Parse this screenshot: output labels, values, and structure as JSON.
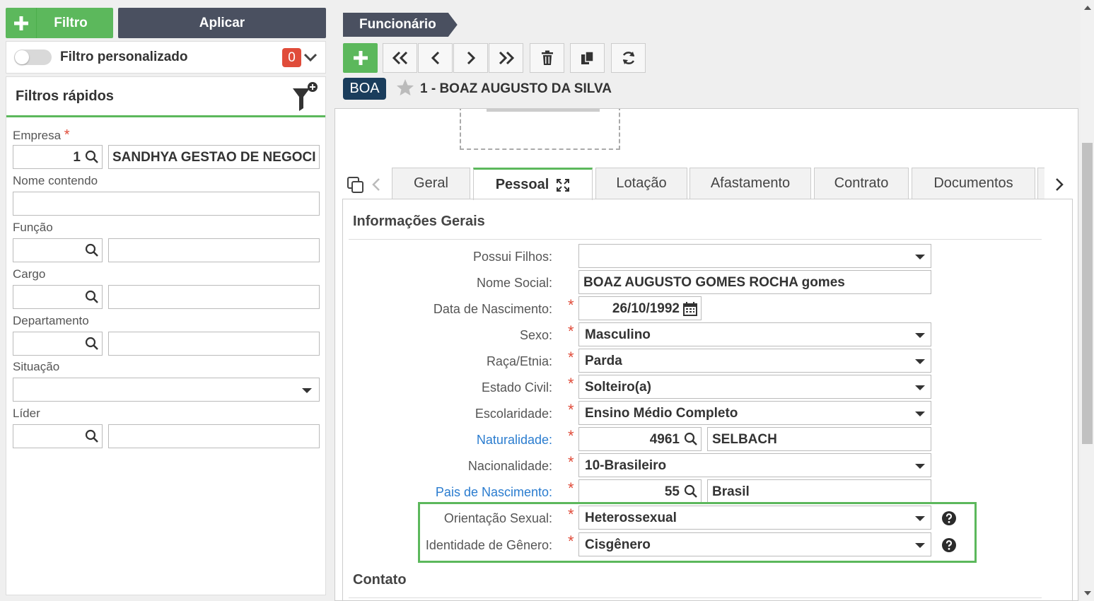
{
  "left": {
    "filter_button": "Filtro",
    "apply_button": "Aplicar",
    "custom_filter": {
      "label": "Filtro personalizado",
      "count": "0"
    },
    "quick_filters": {
      "title": "Filtros rápidos",
      "empresa": {
        "label": "Empresa",
        "code": "1",
        "name": "SANDHYA GESTAO DE NEGOCIOS"
      },
      "nome_contendo": {
        "label": "Nome contendo",
        "value": ""
      },
      "funcao": {
        "label": "Função"
      },
      "cargo": {
        "label": "Cargo"
      },
      "departamento": {
        "label": "Departamento"
      },
      "situacao": {
        "label": "Situação"
      },
      "lider": {
        "label": "Líder"
      }
    }
  },
  "header": {
    "breadcrumb": "Funcionário",
    "abbr": "BOA",
    "record_title": "1 - BOAZ AUGUSTO DA SILVA"
  },
  "tabs": [
    {
      "label": "Geral"
    },
    {
      "label": "Pessoal"
    },
    {
      "label": "Lotação"
    },
    {
      "label": "Afastamento"
    },
    {
      "label": "Contrato"
    },
    {
      "label": "Documentos"
    }
  ],
  "form": {
    "section_general": "Informações Gerais",
    "possui_filhos": {
      "label": "Possui Filhos:",
      "value": ""
    },
    "nome_social": {
      "label": "Nome Social:",
      "value": "BOAZ AUGUSTO GOMES ROCHA gomes"
    },
    "data_nascimento": {
      "label": "Data de Nascimento:",
      "value": "26/10/1992"
    },
    "sexo": {
      "label": "Sexo:",
      "value": "Masculino"
    },
    "raca": {
      "label": "Raça/Etnia:",
      "value": "Parda"
    },
    "estado_civil": {
      "label": "Estado Civil:",
      "value": "Solteiro(a)"
    },
    "escolaridade": {
      "label": "Escolaridade:",
      "value": "Ensino Médio Completo"
    },
    "naturalidade": {
      "label": "Naturalidade:",
      "code": "4961",
      "name": "SELBACH"
    },
    "nacionalidade": {
      "label": "Nacionalidade:",
      "value": "10-Brasileiro"
    },
    "pais_nascimento": {
      "label": "Pais de Nascimento:",
      "code": "55",
      "name": "Brasil"
    },
    "orientacao_sexual": {
      "label": "Orientação Sexual:",
      "value": "Heterossexual"
    },
    "identidade_genero": {
      "label": "Identidade de Gênero:",
      "value": "Cisgênero"
    },
    "section_contact": "Contato"
  },
  "colors": {
    "green": "#5cb85c",
    "dark": "#4a5060",
    "red": "#e04c3a",
    "link": "#2a7ccf",
    "navy": "#1a3d5c"
  }
}
